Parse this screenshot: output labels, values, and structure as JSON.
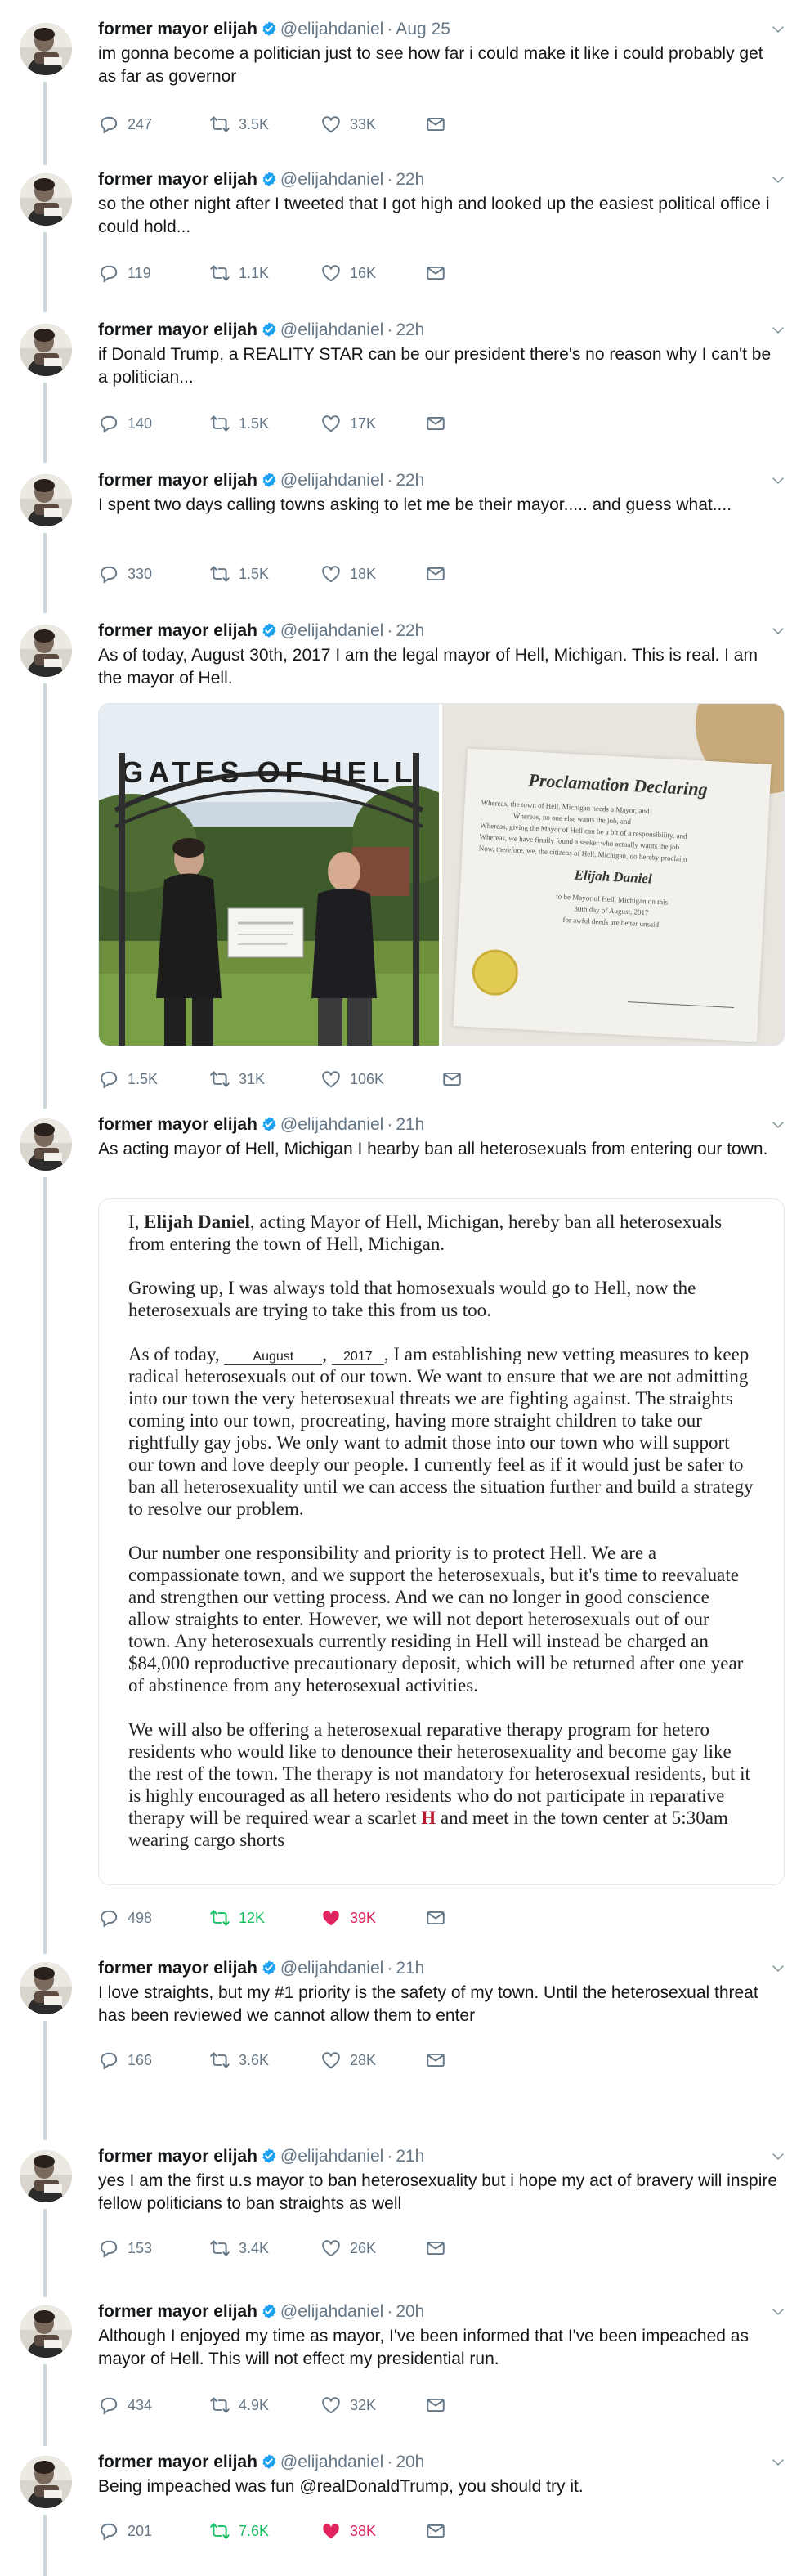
{
  "user": {
    "name": "former mayor elijah",
    "handle": "@elijahdaniel"
  },
  "tweets": [
    {
      "time": "Aug 25",
      "text": "im gonna become a politician just to see how far i could make it like i could probably get as far as governor",
      "replies": "247",
      "retweets": "3.5K",
      "likes": "33K"
    },
    {
      "time": "22h",
      "text": "so the other night after I tweeted that I got high and looked up the easiest political office i could hold...",
      "replies": "119",
      "retweets": "1.1K",
      "likes": "16K"
    },
    {
      "time": "22h",
      "text": "if Donald Trump, a REALITY STAR can be our president there's no reason why I can't be a politician...",
      "replies": "140",
      "retweets": "1.5K",
      "likes": "17K"
    },
    {
      "time": "22h",
      "text": "I spent two days calling towns asking to let me be their mayor..... and guess what....",
      "replies": "330",
      "retweets": "1.5K",
      "likes": "18K"
    },
    {
      "time": "22h",
      "text": "As of today, August 30th, 2017 I am the legal mayor of Hell, Michigan. This is real. I am the mayor of Hell.",
      "replies": "1.5K",
      "retweets": "31K",
      "likes": "106K"
    },
    {
      "time": "21h",
      "text": "As acting mayor of Hell, Michigan I hearby ban all heterosexuals from entering our town.",
      "replies": "498",
      "retweets": "12K",
      "likes": "39K"
    },
    {
      "time": "21h",
      "text": "I love straights, but my #1 priority is the safety of my town. Until the heterosexual threat has been reviewed we cannot allow them to enter",
      "replies": "166",
      "retweets": "3.6K",
      "likes": "28K"
    },
    {
      "time": "21h",
      "text": "yes I am the first u.s mayor to ban heterosexuality but i hope my act of bravery will inspire fellow politicians to ban straights as well",
      "replies": "153",
      "retweets": "3.4K",
      "likes": "26K"
    },
    {
      "time": "20h",
      "text": "Although I enjoyed my time as mayor, I've been informed that I've been impeached as mayor of Hell. This will not effect my presidential run.",
      "replies": "434",
      "retweets": "4.9K",
      "likes": "32K"
    },
    {
      "time": "20h",
      "text": "Being impeached was fun @realDonaldTrump, you should try it.",
      "replies": "201",
      "retweets": "7.6K",
      "likes": "38K"
    }
  ],
  "photo_sign": "GATES OF HELL",
  "proclamation": {
    "title": "Proclamation Declaring",
    "lines": [
      "Whereas, the town of Hell, Michigan needs a Mayor, and",
      "Whereas, no one else wants the job, and",
      "Whereas, giving the Mayor of Hell can be a bit of a responsibility, and",
      "Whereas, we have finally found a seeker who actually wants the job",
      "Now, therefore, we, the citizens of Hell, Michigan, do hereby proclaim",
      "Elijah Daniel",
      "to be Mayor of Hell, Michigan on this",
      "30th day of August, 2017",
      "for awful deeds are better unsaid"
    ]
  },
  "document": {
    "p1_start": "I, ",
    "p1_name": "Elijah Daniel",
    "p1_rest": ", acting Mayor of Hell, Michigan, hereby ban all heterosexuals from entering the town of Hell, Michigan.",
    "p2": "Growing up, I was always told that homosexuals would go to Hell, now the heterosexuals are trying to take this from us too.",
    "p3_start": "As of today, ",
    "p3_month": "August",
    "p3_year": "2017",
    "p3_rest": ", I am establishing new vetting measures to keep radical heterosexuals out of our town. We want to ensure that we are not admitting into our town the very heterosexual threats we are fighting against. The straights coming into our town, procreating, having more straight children to take our rightfully gay jobs. We only want to admit those into our town who will support our town and love deeply our people. I currently feel as if it would just be safer to ban all heterosexuality until we can access the situation further and build a strategy to resolve our problem.",
    "p4": "Our number one responsibility and priority is to protect Hell. We are a compassionate town, and we support the heterosexuals, but it's time to reevaluate and strengthen our vetting process. And we can no longer in good conscience allow straights to enter. However, we will not deport heterosexuals out of our town. Any heterosexuals currently residing in Hell will instead be charged an $84,000 reproductive precautionary deposit, which will be returned after one year of abstinence from any heterosexual activities.",
    "p5_start": "We will also be offering a heterosexual reparative therapy program for hetero residents who would like to denounce their heterosexuality and become gay like the rest of the town. The therapy is not mandatory for heterosexual residents, but it is highly encouraged as all hetero residents who do not participate in reparative therapy will be required wear a scarlet ",
    "p5_h": "H",
    "p5_rest": " and meet in the town center at 5:30am wearing cargo shorts"
  },
  "colors": {
    "text": "#14171a",
    "muted": "#657786",
    "thread": "#ccd6dd",
    "verified": "#1da1f2",
    "retweet_active": "#17bf63",
    "like_active": "#e0245e"
  }
}
